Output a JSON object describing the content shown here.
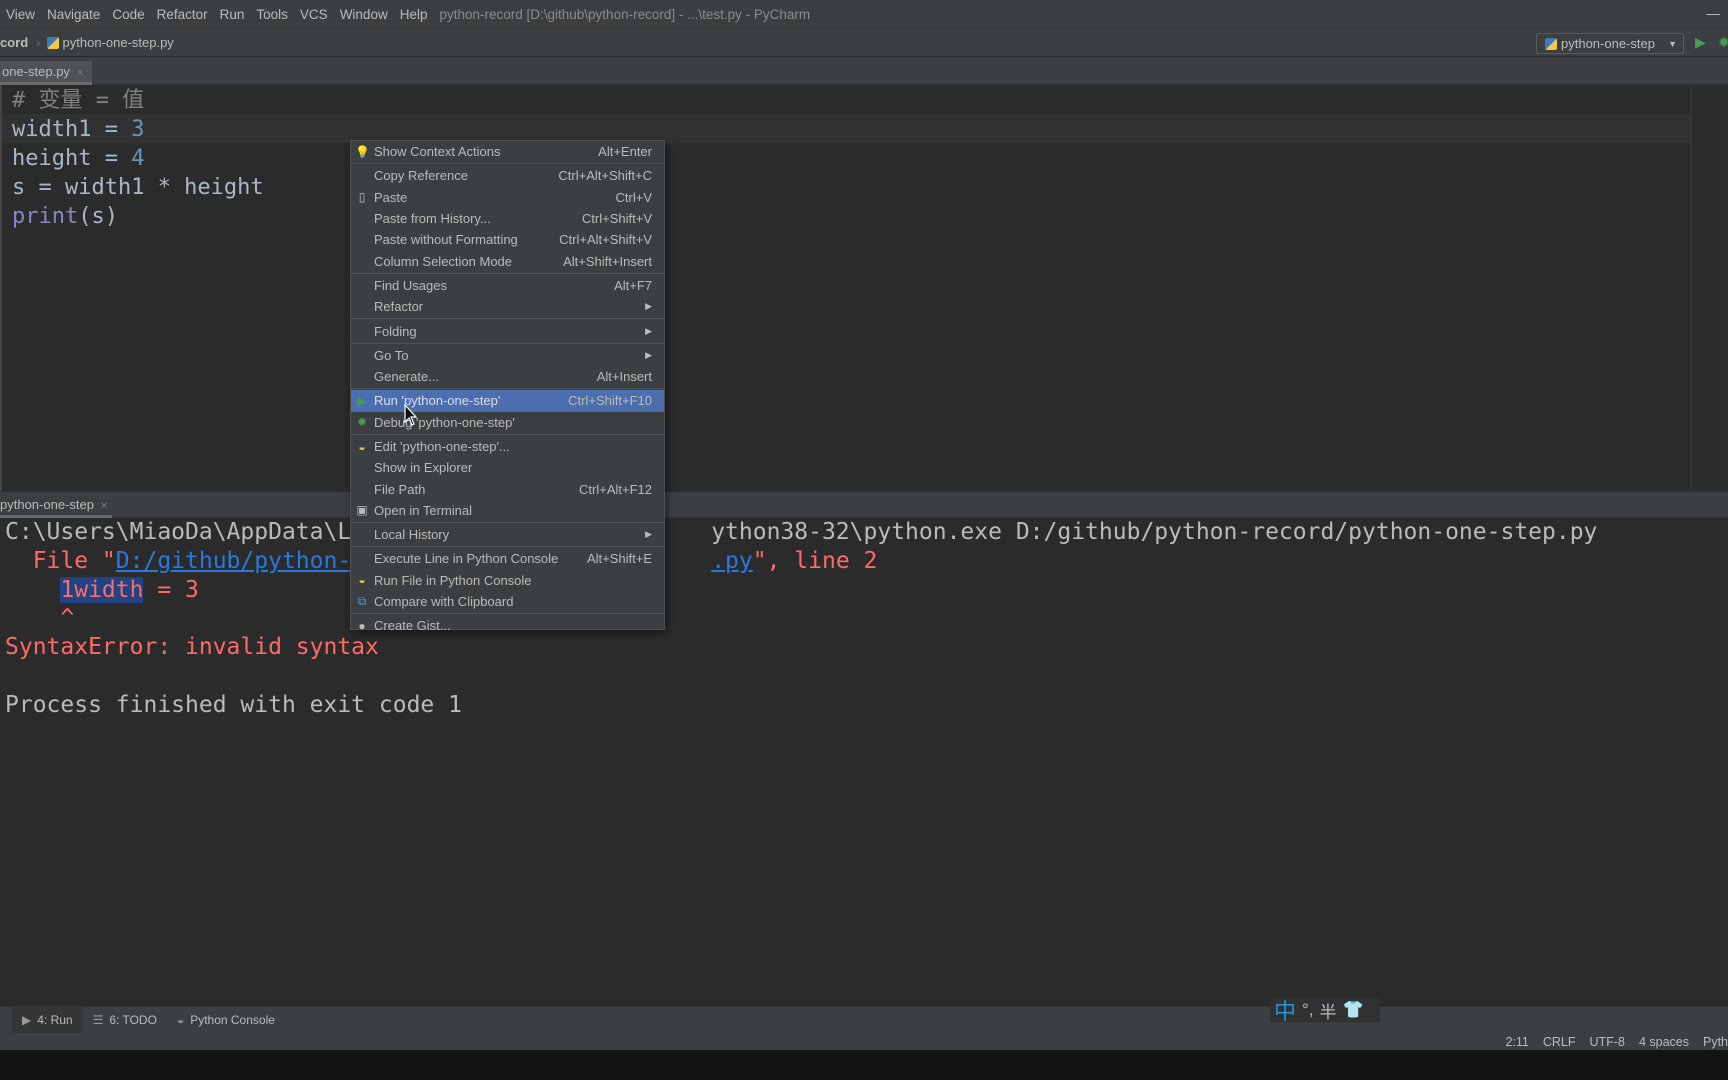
{
  "menubar": {
    "items": [
      "View",
      "Navigate",
      "Code",
      "Refactor",
      "Run",
      "Tools",
      "VCS",
      "Window",
      "Help"
    ],
    "title": "python-record [D:\\github\\python-record] - ...\\test.py - PyCharm",
    "minimize": "—"
  },
  "navbar": {
    "project": "cord",
    "file": "python-one-step.py",
    "run_config": "python-one-step"
  },
  "editor": {
    "tab": "one-step.py",
    "lines": [
      {
        "parts": [
          [
            "cm",
            "# 变量 = 值"
          ]
        ]
      },
      {
        "parts": [
          [
            "",
            "width1 = "
          ],
          [
            "num",
            "3"
          ]
        ]
      },
      {
        "parts": [
          [
            "",
            "height = "
          ],
          [
            "num",
            "4"
          ]
        ]
      },
      {
        "parts": [
          [
            "",
            "s = width1 * height"
          ]
        ]
      },
      {
        "parts": [
          [
            "fn",
            "print"
          ],
          [
            "",
            "(s)"
          ]
        ]
      }
    ]
  },
  "run": {
    "tab": "python-one-step",
    "line1_a": "C:\\Users\\MiaoDa\\AppData\\L",
    "line1_b": "ython38-32\\python.exe D:/github/python-record/python-one-step.py",
    "file_prefix": "  File \"",
    "file_link_a": "D:/github/python-",
    "file_link_b": ".py",
    "file_suffix": "\", line 2",
    "sel_token": "1width",
    "line3_rest": " = 3",
    "caret": "    ^",
    "error": "SyntaxError: invalid syntax",
    "exit": "Process finished with exit code 1"
  },
  "context_menu": {
    "groups": [
      [
        {
          "icon": "lightbulb-icon",
          "glyph": "💡",
          "label": "Show Context Actions",
          "shortcut": "Alt+Enter"
        }
      ],
      [
        {
          "label": "Copy Reference",
          "shortcut": "Ctrl+Alt+Shift+C"
        },
        {
          "icon": "clipboard-icon",
          "glyph": "▯",
          "label": "Paste",
          "shortcut": "Ctrl+V"
        },
        {
          "label": "Paste from History...",
          "shortcut": "Ctrl+Shift+V"
        },
        {
          "label": "Paste without Formatting",
          "shortcut": "Ctrl+Alt+Shift+V"
        },
        {
          "label": "Column Selection Mode",
          "shortcut": "Alt+Shift+Insert"
        }
      ],
      [
        {
          "label": "Find Usages",
          "shortcut": "Alt+F7"
        },
        {
          "label": "Refactor",
          "submenu": true
        }
      ],
      [
        {
          "label": "Folding",
          "submenu": true
        }
      ],
      [
        {
          "label": "Go To",
          "submenu": true
        },
        {
          "label": "Generate...",
          "shortcut": "Alt+Insert"
        }
      ],
      [
        {
          "icon": "run-icon",
          "glyph": "▶",
          "label": "Run 'python-one-step'",
          "shortcut": "Ctrl+Shift+F10",
          "highlighted": true
        },
        {
          "icon": "debug-icon",
          "glyph": "✹",
          "label": "Debug 'python-one-step'"
        }
      ],
      [
        {
          "icon": "python-icon",
          "glyph": "◒",
          "label": "Edit 'python-one-step'..."
        },
        {
          "label": "Show in Explorer"
        },
        {
          "label": "File Path",
          "shortcut": "Ctrl+Alt+F12"
        },
        {
          "icon": "terminal-icon",
          "glyph": "▣",
          "label": "Open in Terminal"
        }
      ],
      [
        {
          "label": "Local History",
          "submenu": true
        }
      ],
      [
        {
          "label": "Execute Line in Python Console",
          "shortcut": "Alt+Shift+E"
        },
        {
          "icon": "python-icon",
          "glyph": "◒",
          "label": "Run File in Python Console"
        },
        {
          "icon": "compare-icon",
          "glyph": "⧉",
          "label": "Compare with Clipboard"
        }
      ],
      [
        {
          "icon": "github-icon",
          "glyph": "●",
          "label": "Create Gist..."
        }
      ]
    ]
  },
  "toolwindows": [
    {
      "icon": "play-icon",
      "glyph": "▶",
      "label": "4: Run",
      "active": true
    },
    {
      "icon": "list-icon",
      "glyph": "☰",
      "label": "6: TODO"
    },
    {
      "icon": "python-icon",
      "glyph": "◒",
      "label": "Python Console"
    }
  ],
  "ime": {
    "mode": "中",
    "punct": "°,",
    "width": "半",
    "skin": "👕"
  },
  "status": {
    "position": "2:11",
    "line_sep": "CRLF",
    "encoding": "UTF-8",
    "indent": "4 spaces",
    "lang": "Pyth"
  },
  "colors": {
    "accent": "#4b6eaf",
    "error": "#ff6b68",
    "link": "#287bde",
    "bg": "#2b2b2b",
    "panel": "#3c3f41"
  }
}
